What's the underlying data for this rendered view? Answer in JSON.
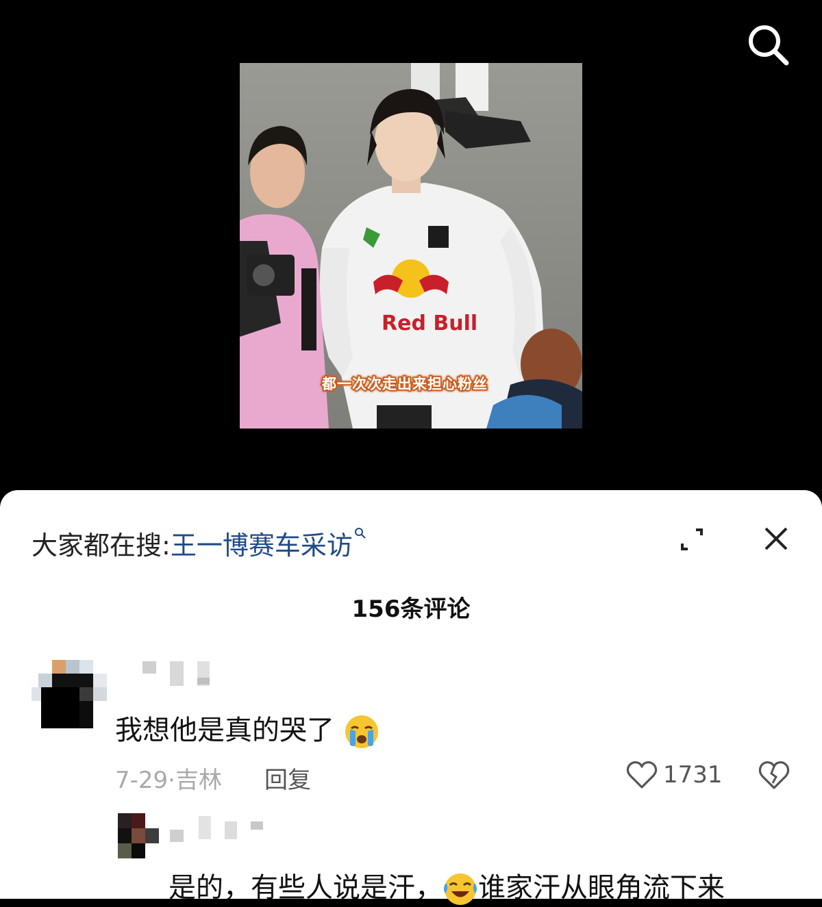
{
  "video": {
    "subtitle": "都一次次走出来担心粉丝",
    "jersey_brand": "Red Bull"
  },
  "icons": {
    "top_search": "search-icon",
    "expand": "expand-icon",
    "close": "close-icon",
    "like": "heart-icon",
    "dislike": "broken-heart-icon"
  },
  "sheet": {
    "hot_search_prefix": "大家都在搜:",
    "hot_search_keyword": "王一博赛车采访",
    "comment_count_title": "156条评论"
  },
  "comments": [
    {
      "text": "我想他是真的哭了",
      "emoji": "crying-face-emoji",
      "meta": "7-29·吉林",
      "reply_label": "回复",
      "likes": "1731"
    }
  ],
  "reply": {
    "text_before": "是的，有些人说是汗，",
    "emoji": "laughing-crying-face-emoji",
    "text_after": "谁家汗从眼角流下来"
  },
  "colors": {
    "keyword_blue": "#1f4a8a",
    "meta_gray": "#a9a9a9"
  }
}
